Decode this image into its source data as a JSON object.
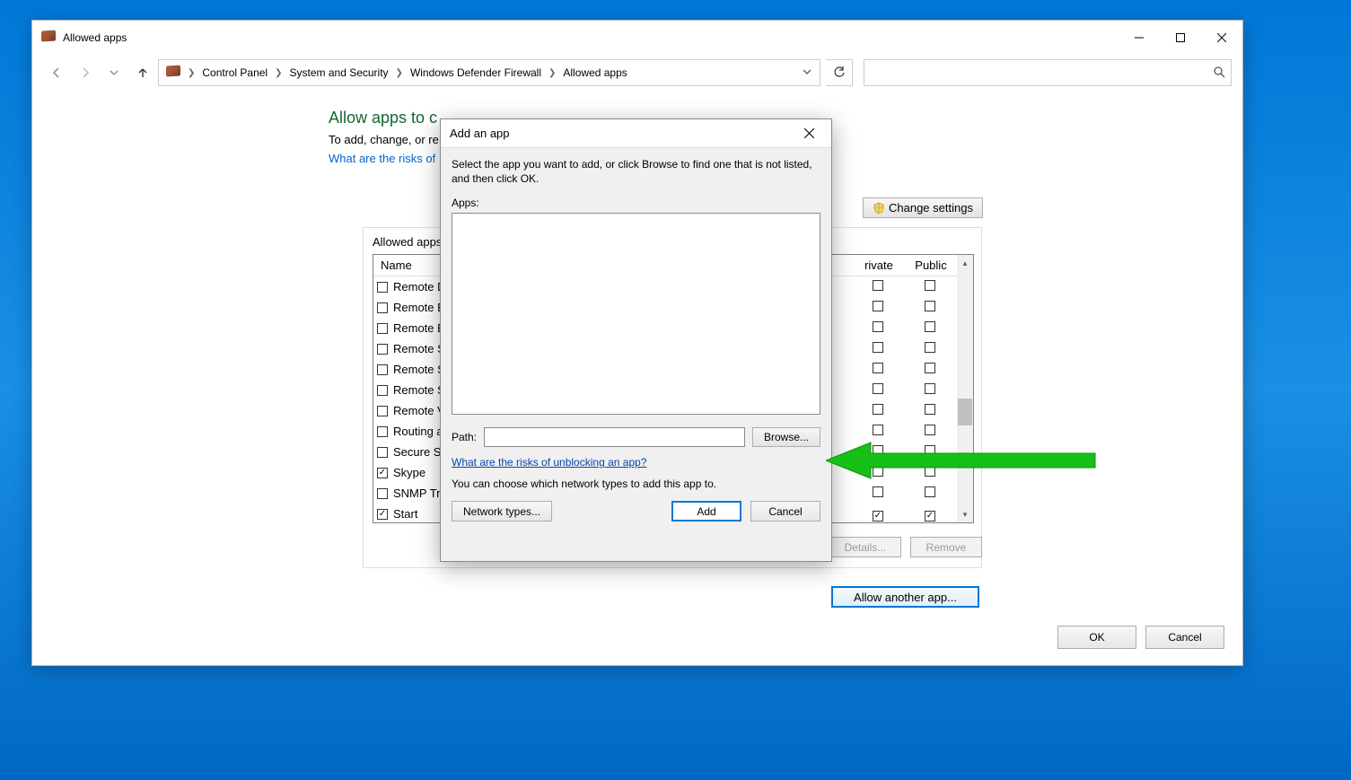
{
  "window": {
    "title": "Allowed apps"
  },
  "breadcrumb": {
    "items": [
      "Control Panel",
      "System and Security",
      "Windows Defender Firewall",
      "Allowed apps"
    ]
  },
  "page": {
    "heading": "Allow apps to c",
    "subtitle": "To add, change, or re",
    "risk_link": "What are the risks of",
    "change_settings": "Change settings",
    "group_title": "Allowed apps and",
    "columns": {
      "name": "Name",
      "private": "rivate",
      "public": "Public"
    },
    "rows": [
      {
        "name": "Remote Deskto",
        "checked": false,
        "private": false,
        "public": false
      },
      {
        "name": "Remote Event L",
        "checked": false,
        "private": false,
        "public": false
      },
      {
        "name": "Remote Event M",
        "checked": false,
        "private": false,
        "public": false
      },
      {
        "name": "Remote Schedu",
        "checked": false,
        "private": false,
        "public": false
      },
      {
        "name": "Remote Service",
        "checked": false,
        "private": false,
        "public": false
      },
      {
        "name": "Remote Shutdo",
        "checked": false,
        "private": false,
        "public": false
      },
      {
        "name": "Remote Volume",
        "checked": false,
        "private": false,
        "public": false
      },
      {
        "name": "Routing and Re",
        "checked": false,
        "private": false,
        "public": false
      },
      {
        "name": "Secure Socket T",
        "checked": false,
        "private": false,
        "public": false
      },
      {
        "name": "Skype",
        "checked": true,
        "private": false,
        "public": false
      },
      {
        "name": "SNMP Trap",
        "checked": false,
        "private": false,
        "public": false
      },
      {
        "name": "Start",
        "checked": true,
        "private": true,
        "public": true
      }
    ],
    "details_btn": "Details...",
    "remove_btn": "Remove",
    "allow_another": "Allow another app...",
    "ok": "OK",
    "cancel": "Cancel"
  },
  "dialog": {
    "title": "Add an app",
    "instruction": "Select the app you want to add, or click Browse to find one that is not listed, and then click OK.",
    "apps_label": "Apps:",
    "path_label": "Path:",
    "path_value": "",
    "browse": "Browse...",
    "risk_link": "What are the risks of unblocking an app?",
    "note": "You can choose which network types to add this app to.",
    "network_types": "Network types...",
    "add": "Add",
    "cancel": "Cancel"
  }
}
